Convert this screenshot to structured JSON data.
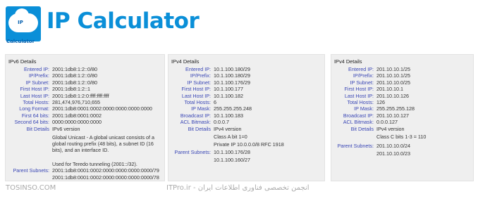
{
  "header": {
    "logo_text": "IP Calculator",
    "title": "IP Calculator"
  },
  "ipv6": {
    "title": "IPv6 Details",
    "rows": [
      {
        "label": "Entered IP:",
        "value": "2001:1db8:1:2::0/80"
      },
      {
        "label": "IP/Prefix:",
        "value": "2001:1db8:1:2::0/80"
      },
      {
        "label": "IP Subnet:",
        "value": "2001:1db8:1:2::0/80"
      },
      {
        "label": "First Host IP:",
        "value": "2001:1db8:1:2::1"
      },
      {
        "label": "Last Host IP:",
        "value": "2001:1db8:1:2:0:ffff:ffff:ffff"
      },
      {
        "label": "Total Hosts:",
        "value": "281,474,976,710,655"
      },
      {
        "label": "Long Format:",
        "value": "2001:1db8:0001:0002:0000:0000:0000:0000"
      },
      {
        "label": "First 64 bits:",
        "value": "2001:1db8:0001:0002"
      },
      {
        "label": "Second 64 bits:",
        "value": "0000:0000:0000:0000"
      }
    ],
    "bit_details_label": "Bit Details",
    "bit_details": [
      "IPv6 version",
      "Global Unicast - A global unicast consists of a global routing prefix (48 bits), a subnet ID (16 bits), and an interface ID.",
      "Used for Teredo tunneling (2001::/32)."
    ],
    "parent_label": "Parent Subnets:",
    "parent_subnets": [
      "2001:1db8:0001:0002:0000:0000:0000:0000/79",
      "2001:1db8:0001:0002:0000:0000:0000:0000/78"
    ]
  },
  "ipv4a": {
    "title": "IPv4 Details",
    "rows": [
      {
        "label": "Entered IP:",
        "value": "10.1.100.180/29"
      },
      {
        "label": "IP/Prefix:",
        "value": "10.1.100.180/29"
      },
      {
        "label": "IP Subnet:",
        "value": "10.1.100.176/29"
      },
      {
        "label": "First Host IP:",
        "value": "10.1.100.177"
      },
      {
        "label": "Last Host IP:",
        "value": "10.1.100.182"
      },
      {
        "label": "Total Hosts:",
        "value": "6"
      },
      {
        "label": "IP Mask:",
        "value": "255.255.255.248"
      },
      {
        "label": "Broadcast IP:",
        "value": "10.1.100.183"
      },
      {
        "label": "ACL Bitmask:",
        "value": "0.0.0.7"
      }
    ],
    "bit_details_label": "Bit Details",
    "bit_details": [
      "IPv4 version",
      "Class A bit 1=0",
      "Private IP 10.0.0.0/8 RFC 1918"
    ],
    "parent_label": "Parent Subnets:",
    "parent_subnets": [
      "10.1.100.176/28",
      "10.1.100.160/27"
    ]
  },
  "ipv4b": {
    "title": "IPv4 Details",
    "rows": [
      {
        "label": "Entered IP:",
        "value": "201.10.10.1/25"
      },
      {
        "label": "IP/Prefix:",
        "value": "201.10.10.1/25"
      },
      {
        "label": "IP Subnet:",
        "value": "201.10.10.0/25"
      },
      {
        "label": "First Host IP:",
        "value": "201.10.10.1"
      },
      {
        "label": "Last Host IP:",
        "value": "201.10.10.126"
      },
      {
        "label": "Total Hosts:",
        "value": "126"
      },
      {
        "label": "IP Mask:",
        "value": "255.255.255.128"
      },
      {
        "label": "Broadcast IP:",
        "value": "201.10.10.127"
      },
      {
        "label": "ACL Bitmask:",
        "value": "0.0.0.127"
      }
    ],
    "bit_details_label": "Bit Details",
    "bit_details": [
      "IPv4 version",
      "Class C bits 1-3 = 110"
    ],
    "parent_label": "Parent Subnets:",
    "parent_subnets": [
      "201.10.10.0/24",
      "201.10.10.0/23"
    ]
  },
  "watermark": {
    "left": "TOSINSO.COM",
    "center": "انجمن تخصصی فناوری اطلاعات ایران - ITPro.ir"
  }
}
